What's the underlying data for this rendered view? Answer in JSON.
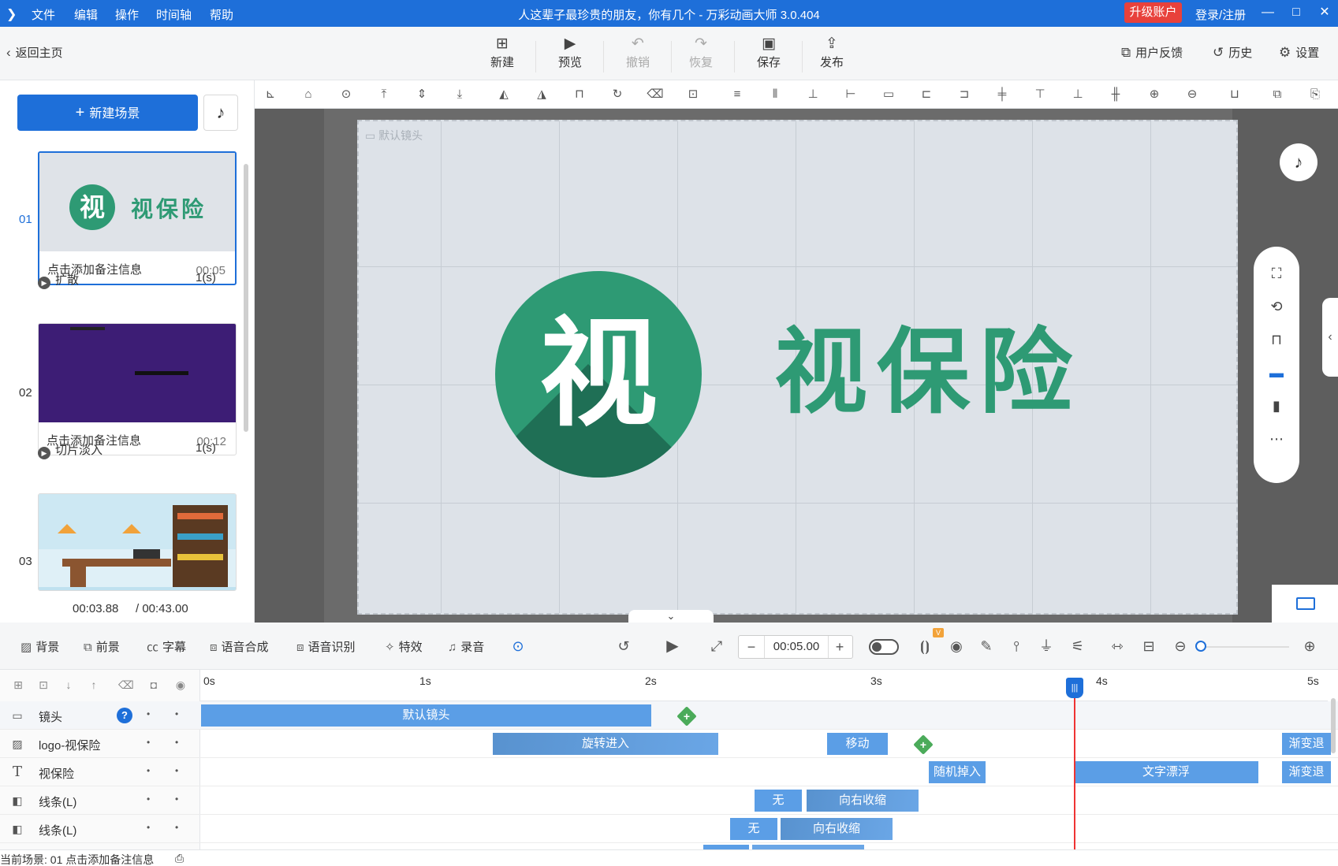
{
  "titlebar": {
    "menu": [
      "文件",
      "编辑",
      "操作",
      "时间轴",
      "帮助"
    ],
    "title": "人这辈子最珍贵的朋友，你有几个 - 万彩动画大师 3.0.404",
    "upgrade": "升级账户",
    "login": "登录/注册",
    "minimize": "—",
    "maximize": "□",
    "close": "✕"
  },
  "toolbar": {
    "back": "返回主页",
    "buttons": [
      {
        "label": "新建",
        "icon": "plus-square-icon"
      },
      {
        "label": "预览",
        "icon": "play-icon"
      },
      {
        "label": "撤销",
        "icon": "undo-icon"
      },
      {
        "label": "恢复",
        "icon": "redo-icon"
      },
      {
        "label": "保存",
        "icon": "save-icon"
      },
      {
        "label": "发布",
        "icon": "publish-icon"
      }
    ],
    "feedback": "用户反馈",
    "history": "历史",
    "settings": "设置"
  },
  "scenes": {
    "new_scene": "新建场景",
    "items": [
      {
        "no": "01",
        "note": "点击添加备注信息",
        "duration": "00:05"
      },
      {
        "no": "02",
        "note": "点击添加备注信息",
        "duration": "00:12"
      },
      {
        "no": "03"
      }
    ],
    "transitions": [
      {
        "name": "扩散",
        "time": "1(s)"
      },
      {
        "name": "切片淡入",
        "time": "1(s)"
      }
    ],
    "time_current": "00:03.88",
    "time_total": "/ 00:43.00"
  },
  "canvas": {
    "camera_label": "默认镜头",
    "logo_char": "视",
    "brand_text": "视保险",
    "brand_color": "#2e9a74",
    "thumb1_text": "视保险"
  },
  "timeline_toolbar": {
    "items": [
      "背景",
      "前景",
      "字幕",
      "语音合成",
      "语音识别",
      "特效",
      "录音"
    ],
    "time_value": "00:05.00",
    "badge": "V"
  },
  "timeline": {
    "ruler": [
      "0s",
      "1s",
      "2s",
      "3s",
      "4s",
      "5s"
    ],
    "playhead_time_s": 3.88,
    "tracks": [
      {
        "name": "镜头",
        "icon": "camera-icon",
        "clips": [
          {
            "label": "默认镜头"
          }
        ]
      },
      {
        "name": "logo-视保险",
        "icon": "image-icon",
        "clips": [
          {
            "label": "旋转进入"
          },
          {
            "label": "移动"
          },
          {
            "label": "渐变退"
          }
        ]
      },
      {
        "name": "视保险",
        "icon": "text-icon",
        "clips": [
          {
            "label": "随机掉入"
          },
          {
            "label": "文字漂浮"
          },
          {
            "label": "渐变退"
          }
        ]
      },
      {
        "name": "线条(L)",
        "icon": "shape-icon",
        "clips": [
          {
            "label": "无"
          },
          {
            "label": "向右收缩"
          }
        ]
      },
      {
        "name": "线条(L)",
        "icon": "shape-icon",
        "clips": [
          {
            "label": "无"
          },
          {
            "label": "向右收缩"
          }
        ]
      }
    ]
  },
  "status": {
    "text": "当前场景: 01   点击添加备注信息"
  }
}
